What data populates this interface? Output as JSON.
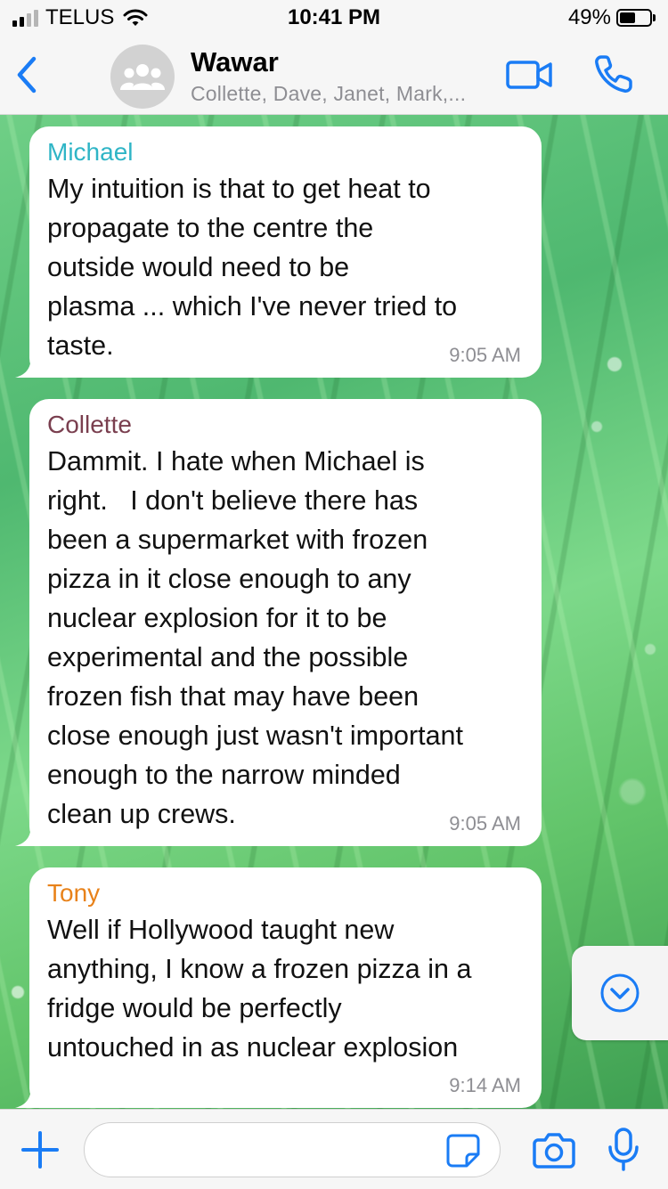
{
  "status_bar": {
    "carrier": "TELUS",
    "time": "10:41 PM",
    "battery_percent": "49%",
    "battery_level": 0.49,
    "icons": [
      "signal-icon",
      "wifi-icon",
      "battery-icon"
    ]
  },
  "header": {
    "back_icon": "chevron-left-icon",
    "avatar_icon": "group-icon",
    "title": "Wawar",
    "subtitle": "Collette, Dave, Janet, Mark,...",
    "video_icon": "video-camera-icon",
    "call_icon": "phone-icon"
  },
  "colors": {
    "accent": "#1a7cf5",
    "michael": "#2fb5c6",
    "collette": "#7a3f4f",
    "tony": "#e8821a"
  },
  "messages": [
    {
      "sender": "Michael",
      "lines": [
        "My intuition is that to get heat to",
        "propagate to the centre the",
        "outside would need to be",
        "plasma ... which I've never tried to",
        "taste."
      ],
      "time": "9:05 AM"
    },
    {
      "sender": "Collette",
      "lines": [
        "Dammit. I hate when Michael is",
        "right.   I don't believe there has",
        "been a supermarket with frozen",
        "pizza in it close enough to any",
        "nuclear explosion for it to be",
        "experimental and the possible",
        "frozen fish that may have been",
        "close enough just wasn't important",
        "enough to the narrow minded",
        "clean up crews."
      ],
      "time": "9:05 AM"
    },
    {
      "sender": "Tony",
      "lines": [
        "Well if Hollywood taught new",
        "anything, I know a frozen pizza in a",
        "fridge would be perfectly",
        "untouched in as nuclear explosion"
      ],
      "time": "9:14 AM"
    }
  ],
  "scroll_down_icon": "chevron-down-circle-icon",
  "input_bar": {
    "plus_icon": "plus-icon",
    "message_value": "",
    "sticker_icon": "sticker-icon",
    "camera_icon": "camera-icon",
    "mic_icon": "microphone-icon"
  }
}
